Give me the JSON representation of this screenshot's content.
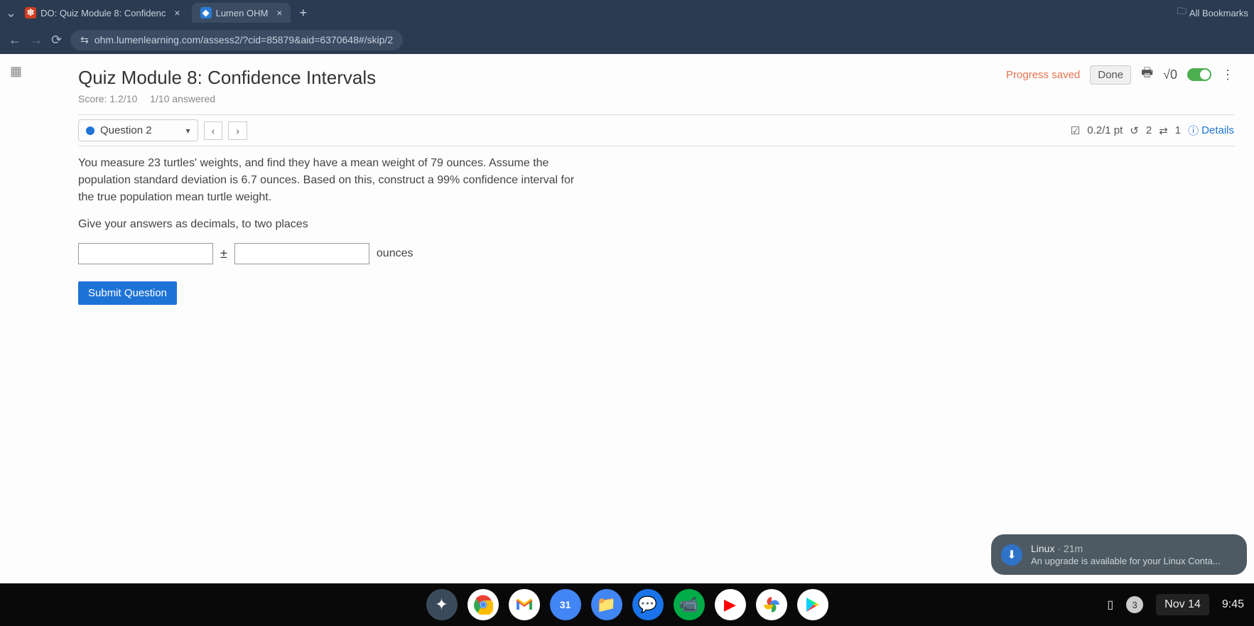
{
  "browser": {
    "tabs": [
      {
        "icon_color": "#d04020",
        "title": "DO: Quiz Module 8: Confidenc"
      },
      {
        "icon_color": "#2a7bd6",
        "title": "Lumen OHM"
      }
    ],
    "new_tab": "+",
    "all_bookmarks": "All Bookmarks",
    "url": "ohm.lumenlearning.com/assess2/?cid=85879&aid=6370648#/skip/2"
  },
  "toolbar": {
    "progress_saved": "Progress saved",
    "done": "Done",
    "sqrt": "√0"
  },
  "quiz": {
    "title": "Quiz Module 8: Confidence Intervals",
    "score": "Score: 1.2/10",
    "answered": "1/10 answered"
  },
  "qnav": {
    "label": "Question 2",
    "prev": "‹",
    "next": "›",
    "points": "0.2/1 pt",
    "retry_icon": "↺",
    "retry_count": "2",
    "reattempt_icon": "⇄",
    "reattempt_count": "1",
    "details": "Details"
  },
  "question": {
    "p1": "You measure 23 turtles' weights, and find they have a mean weight of 79 ounces. Assume the population standard deviation is 6.7 ounces. Based on this, construct a 99% confidence interval for the true population mean turtle weight.",
    "p2": "Give your answers as decimals, to two places",
    "pm": "±",
    "units": "ounces",
    "submit": "Submit Question"
  },
  "notification": {
    "title": "Linux",
    "time": "21m",
    "body": "An upgrade is available for your Linux Conta..."
  },
  "shelf": {
    "notif_count": "3",
    "date": "Nov 14",
    "time": "9:45"
  }
}
